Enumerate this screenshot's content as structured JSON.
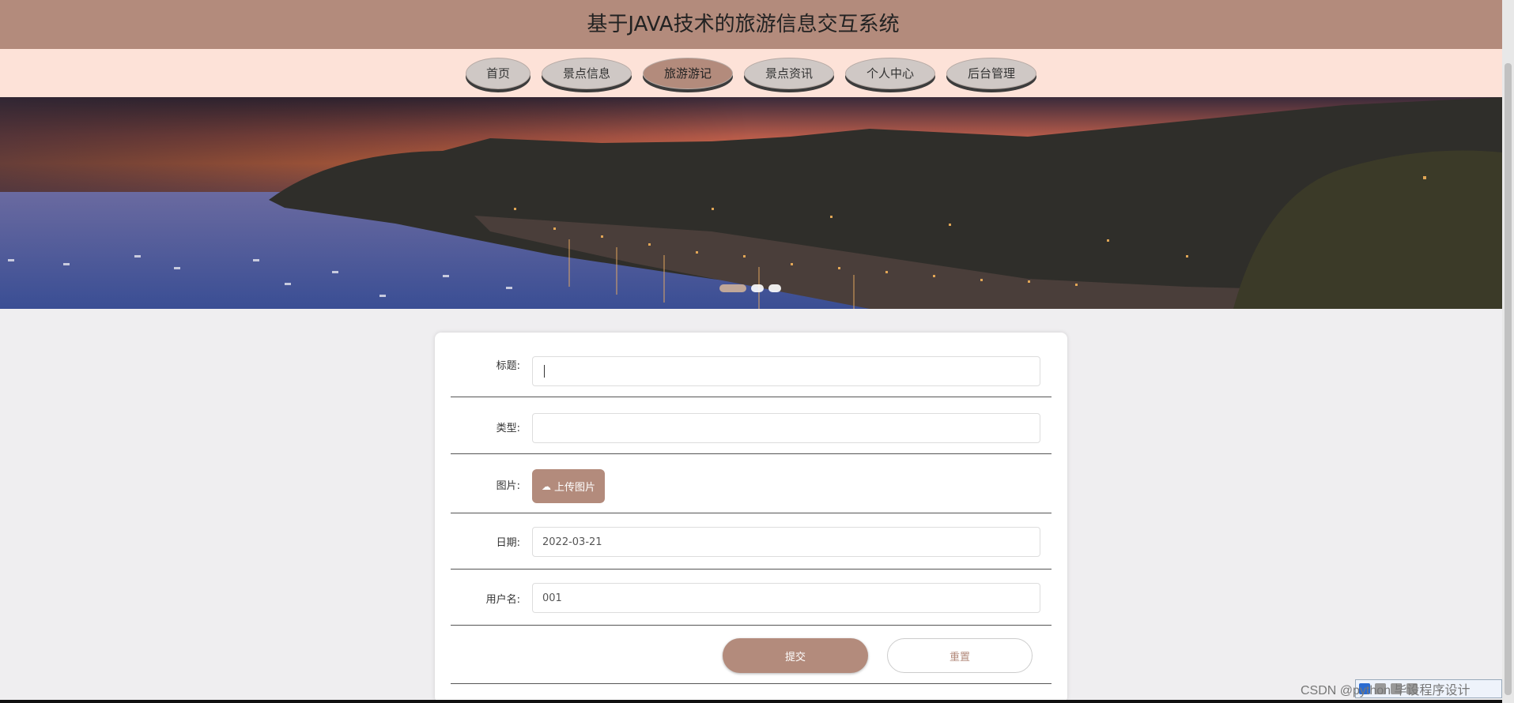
{
  "header": {
    "title": "基于JAVA技术的旅游信息交互系统"
  },
  "nav": {
    "items": [
      {
        "label": "首页"
      },
      {
        "label": "景点信息"
      },
      {
        "label": "旅游游记"
      },
      {
        "label": "景点资讯"
      },
      {
        "label": "个人中心"
      },
      {
        "label": "后台管理"
      }
    ],
    "active": "旅游游记"
  },
  "banner": {
    "slides": 3,
    "active_slide": 1
  },
  "form": {
    "title_label": "标题:",
    "title_value": "",
    "type_label": "类型:",
    "type_value": "",
    "image_label": "图片:",
    "upload_label": "上传图片",
    "date_label": "日期:",
    "date_value": "2022-03-21",
    "username_label": "用户名:",
    "username_value": "001",
    "submit_label": "提交",
    "reset_label": "重置"
  },
  "watermark": "CSDN @python 毕设程序设计",
  "colors": {
    "accent": "#b38b7c",
    "nav_bg": "#fde2d8",
    "page_bg": "#efeef0"
  }
}
